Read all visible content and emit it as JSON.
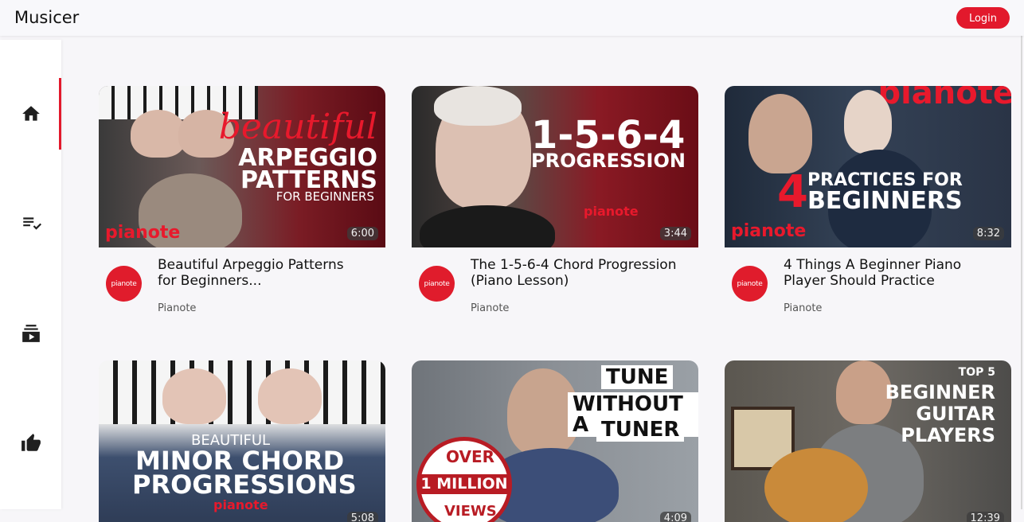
{
  "app": {
    "title": "Musicer",
    "login_label": "Login"
  },
  "sidebar": {
    "items": [
      {
        "name": "home",
        "icon": "home-icon",
        "active": true
      },
      {
        "name": "playlist",
        "icon": "playlist-check-icon",
        "active": false
      },
      {
        "name": "subscriptions",
        "icon": "subscriptions-icon",
        "active": false
      },
      {
        "name": "liked",
        "icon": "thumb-up-icon",
        "active": false
      }
    ]
  },
  "colors": {
    "accent": "#e2192c",
    "background": "#f7f6f9"
  },
  "videos": [
    {
      "title": "Beautiful Arpeggio Patterns for Beginners...",
      "channel": "Pianote",
      "avatar_text": "pianote",
      "duration": "6:00",
      "thumb_lines": [
        "beautiful",
        "ARPEGGIO",
        "PATTERNS",
        "FOR BEGINNERS"
      ],
      "brand": "pianote"
    },
    {
      "title": "The 1-5-6-4 Chord Progression (Piano Lesson)",
      "channel": "Pianote",
      "avatar_text": "pianote",
      "duration": "3:44",
      "thumb_lines": [
        "1-5-6-4",
        "PROGRESSION"
      ],
      "brand": "pianote"
    },
    {
      "title": "4 Things A Beginner Piano Player Should Practice",
      "channel": "Pianote",
      "avatar_text": "pianote",
      "duration": "8:32",
      "thumb_lines": [
        "4",
        "PRACTICES FOR",
        "BEGINNERS"
      ],
      "brand": "pianote"
    },
    {
      "title": "",
      "channel": "",
      "avatar_text": "",
      "duration": "5:08",
      "thumb_lines": [
        "BEAUTIFUL",
        "MINOR CHORD",
        "PROGRESSIONS"
      ],
      "brand": "pianote"
    },
    {
      "title": "",
      "channel": "",
      "avatar_text": "",
      "duration": "4:09",
      "thumb_lines": [
        "TUNE",
        "WITHOUT A",
        "TUNER",
        "OVER",
        "1 MILLION",
        "VIEWS"
      ],
      "brand": ""
    },
    {
      "title": "",
      "channel": "",
      "avatar_text": "",
      "duration": "12:39",
      "thumb_lines": [
        "TOP 5",
        "BEGINNER",
        "GUITAR",
        "PLAYERS"
      ],
      "brand": ""
    }
  ]
}
